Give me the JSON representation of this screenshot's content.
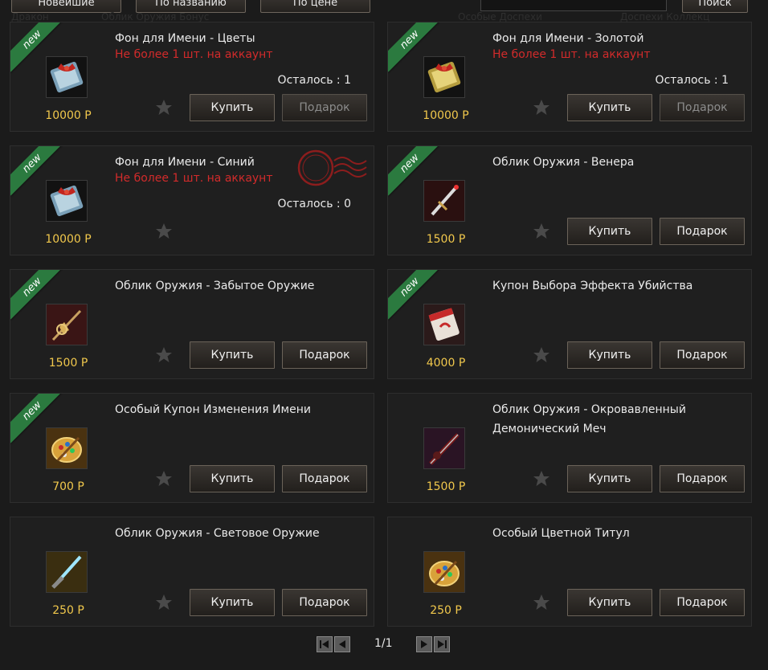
{
  "sort": {
    "newest": "Новейшие",
    "by_name": "По названию",
    "by_price": "По цене"
  },
  "search": {
    "button": "Поиск",
    "placeholder": ""
  },
  "background_ghost": [
    "Дракон",
    "Облик Оружия Бонус",
    "Особые Доспехи",
    "Доспехи Коллекц"
  ],
  "labels": {
    "buy": "Купить",
    "gift": "Подарок",
    "limit": "Не более 1 шт. на аккаунт",
    "remaining_prefix": "Осталось : ",
    "new_badge": "new"
  },
  "items": [
    {
      "title": "Фон для Имени - Цветы",
      "price": "10000 P",
      "limit": true,
      "remaining": "1",
      "is_new": true,
      "icon": "name-bg-ticket-blue-icon"
    },
    {
      "title": "Фон для Имени - Золотой",
      "price": "10000 P",
      "limit": true,
      "remaining": "1",
      "is_new": true,
      "icon": "name-bg-ticket-gold-icon"
    },
    {
      "title": "Фон для Имени - Синий",
      "price": "10000 P",
      "limit": true,
      "remaining": "0",
      "is_new": true,
      "sold_out": true,
      "icon": "name-bg-ticket-blue-icon"
    },
    {
      "title": "Облик Оружия - Венера",
      "price": "1500 P",
      "is_new": true,
      "icon": "weapon-venus-icon"
    },
    {
      "title": "Облик Оружия - Забытое Оружие",
      "price": "1500 P",
      "is_new": true,
      "icon": "weapon-forgotten-icon"
    },
    {
      "title": "Купон Выбора Эффекта Убийства",
      "price": "4000 P",
      "is_new": true,
      "icon": "kill-effect-coupon-icon"
    },
    {
      "title": "Особый Купон Изменения Имени",
      "price": "700 P",
      "is_new": true,
      "icon": "palette-coupon-icon"
    },
    {
      "title": "Облик Оружия - Окровавленный Демонический Меч",
      "price": "1500 P",
      "is_new": false,
      "icon": "bloody-demon-sword-icon"
    },
    {
      "title": "Облик Оружия - Световое Оружие",
      "price": "250 P",
      "is_new": false,
      "icon": "light-weapon-icon"
    },
    {
      "title": "Особый Цветной Титул",
      "price": "250 P",
      "is_new": false,
      "icon": "palette-title-icon"
    }
  ],
  "pager": {
    "label": "1/1"
  },
  "colors": {
    "price": "#f1c84c",
    "limit": "#d22b2b",
    "ribbon": "#2b7a3f"
  }
}
